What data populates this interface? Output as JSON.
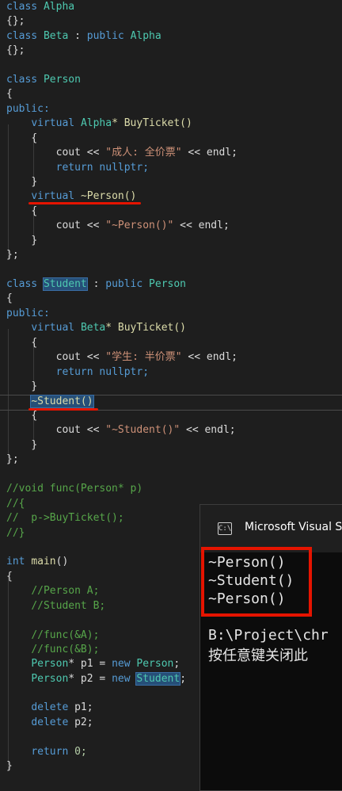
{
  "code": {
    "l1": "class Alpha",
    "l2": "{};",
    "l3_kw": "class",
    "l3_name": "Beta",
    "l3_colon": " : ",
    "l3_kw2": "public",
    "l3_base": "Alpha",
    "l4": "{};",
    "l6_kw": "class",
    "l6_name": "Person",
    "brace_open": "{",
    "public_label": "public:",
    "virtual": "virtual",
    "person_buy_type": "Alpha",
    "person_buy_fn": "* BuyTicket()",
    "person_buy_open": "{",
    "cout_person_a": "cout << ",
    "cout_person_str": "\"成人: 全价票\"",
    "cout_person_b": " << endl;",
    "return_kw": "return",
    "nullptr": "nullptr;",
    "close_brace": "}",
    "person_dtor": "~Person()",
    "cout_pdtor_str": "\"~Person()\"",
    "end_class": "};",
    "student_kw": "class",
    "student_name": "Student",
    "student_colon": " : ",
    "student_public": "public",
    "student_base": "Person",
    "student_buy_type": "Beta",
    "student_buy_fn": "* BuyTicket()",
    "cout_student_str": "\"学生: 半价票\"",
    "student_dtor": "~Student()",
    "cout_sdtor_str": "\"~Student()\"",
    "cm1": "//void func(Person* p)",
    "cm2": "//{",
    "cm3": "//  p->BuyTicket();",
    "cm4": "//}",
    "int_kw": "int",
    "main_fn": "main",
    "main_paren": "()",
    "cm5": "//Person A;",
    "cm6": "//Student B;",
    "cm7": "//func(&A);",
    "cm8": "//func(&B);",
    "p1_type": "Person",
    "p1_mid": "* p1 = ",
    "new_kw": "new",
    "p1_new": "Person",
    "p2_type": "Person",
    "p2_mid": "* p2 = ",
    "p2_new": "Student",
    "delete_kw": "delete",
    "del_p1": "p1;",
    "del_p2": "p2;",
    "ret_zero": "0;"
  },
  "console": {
    "title": "Microsoft Visual S",
    "icon_label": "C:\\",
    "outputs": [
      "~Person()",
      "~Student()",
      "~Person()"
    ],
    "path_line": "B:\\Project\\chr",
    "close_msg": "按任意键关闭此"
  },
  "colors": {
    "highlight_red": "#e51400",
    "editor_bg": "#1e1e1e",
    "console_bg": "#0c0c0c"
  }
}
